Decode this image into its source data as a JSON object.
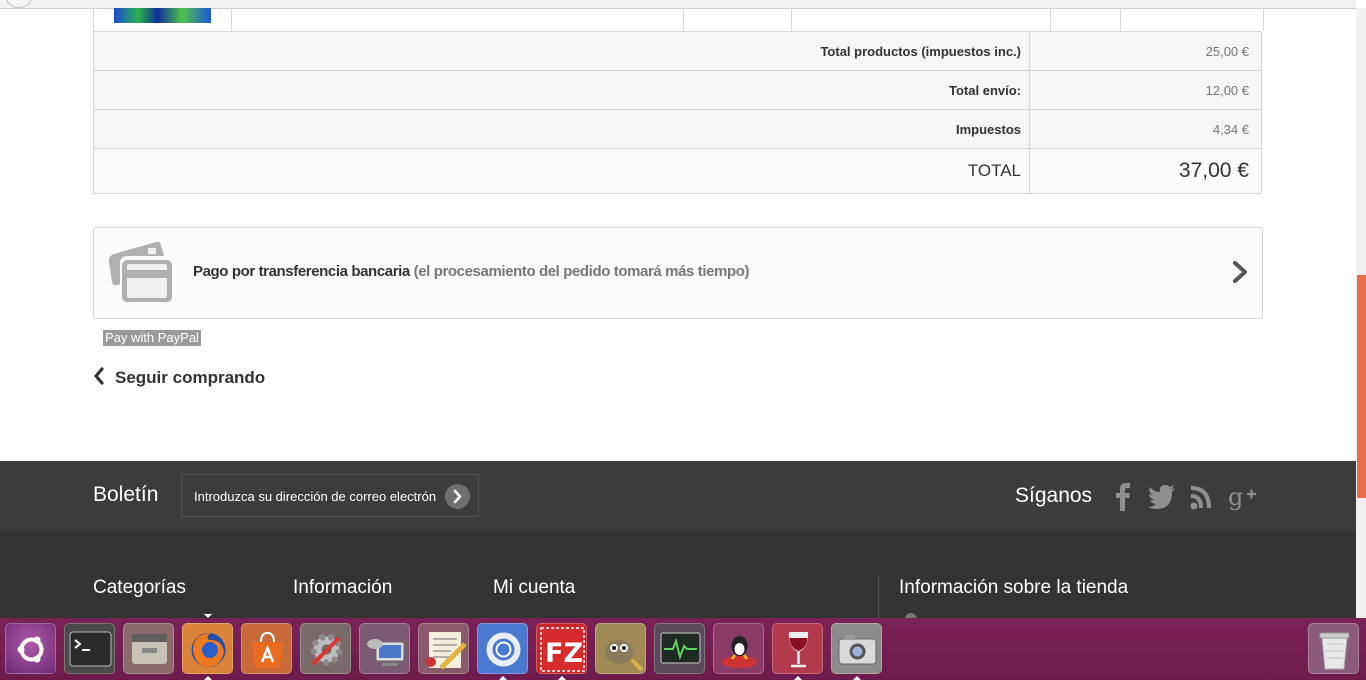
{
  "totals": {
    "rows": [
      {
        "label": "Total productos (impuestos inc.)",
        "value": "25,00 €"
      },
      {
        "label": "Total envío:",
        "value": "12,00 €"
      },
      {
        "label": "Impuestos",
        "value": "4,34 €"
      }
    ],
    "total_label": "TOTAL",
    "total_value": "37,00 €"
  },
  "payment": {
    "title": "Pago por transferencia bancaria",
    "subtitle": "(el procesamiento del pedido tomará más tiempo)",
    "icon": "credit-card-icon"
  },
  "paypal_label": "Pay with PayPal",
  "continue_label": "Seguir comprando",
  "footer": {
    "newsletter_title": "Boletín",
    "newsletter_placeholder": "Introduzca su dirección de correo electrón",
    "follow_title": "Síganos",
    "social_icons": [
      "facebook-icon",
      "twitter-icon",
      "rss-icon",
      "google-plus-icon"
    ],
    "columns": [
      "Categorías",
      "Información",
      "Mi cuenta",
      "Información sobre la tienda"
    ]
  },
  "dock": {
    "apps": [
      "ubuntu-dash-icon",
      "terminal-icon",
      "file-manager-icon",
      "firefox-icon",
      "software-center-icon",
      "system-settings-icon",
      "remote-desktop-icon",
      "text-editor-icon",
      "chromium-icon",
      "filezilla-icon",
      "gimp-icon",
      "system-monitor-icon",
      "game-icon",
      "wine-icon",
      "screenshot-icon",
      "trash-icon"
    ],
    "filezilla_text": "FZ"
  },
  "colors": {
    "accent": "#e96f4a",
    "footer_dark": "#333333",
    "footer_band": "#3c3c3c",
    "dock": "#6d1b4d"
  }
}
